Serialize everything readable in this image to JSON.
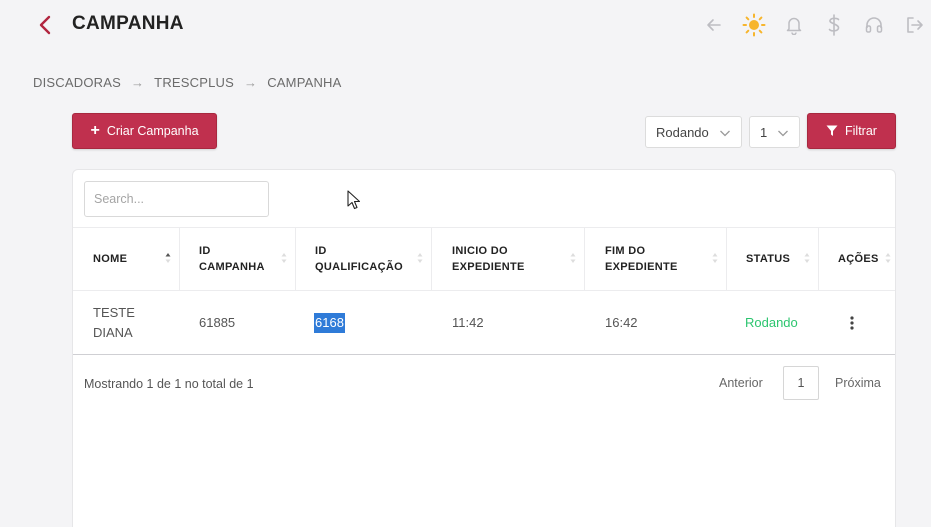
{
  "header": {
    "title": "CAMPANHA",
    "accent_color": "#b1253f",
    "icons": [
      "arrow-left-icon",
      "sun-icon",
      "bell-icon",
      "dollar-icon",
      "headset-icon",
      "logout-icon"
    ]
  },
  "breadcrumb": {
    "items": [
      "DISCADORAS",
      "TRESCPLUS",
      "CAMPANHA"
    ],
    "separator": "→"
  },
  "toolbar": {
    "create_label": "Criar Campanha",
    "status_select": "Rodando",
    "page_select": "1",
    "filter_label": "Filtrar",
    "button_color": "#c0304e"
  },
  "table": {
    "search_placeholder": "Search...",
    "columns": [
      "NOME",
      "ID\nCAMPANHA",
      "ID\nQUALIFICAÇÃO",
      "INICIO DO\nEXPEDIENTE",
      "FIM DO\nEXPEDIENTE",
      "STATUS",
      "AÇÕES"
    ],
    "rows": [
      {
        "nome": "TESTE\nDIANA",
        "id_campanha": "61885",
        "id_qualificacao": "6168",
        "inicio": "11:42",
        "fim": "16:42",
        "status": "Rodando",
        "status_color": "#2cc56f"
      }
    ]
  },
  "pagination": {
    "summary": "Mostrando 1 de 1 no total de 1",
    "prev_label": "Anterior",
    "current_page": "1",
    "next_label": "Próxima"
  }
}
